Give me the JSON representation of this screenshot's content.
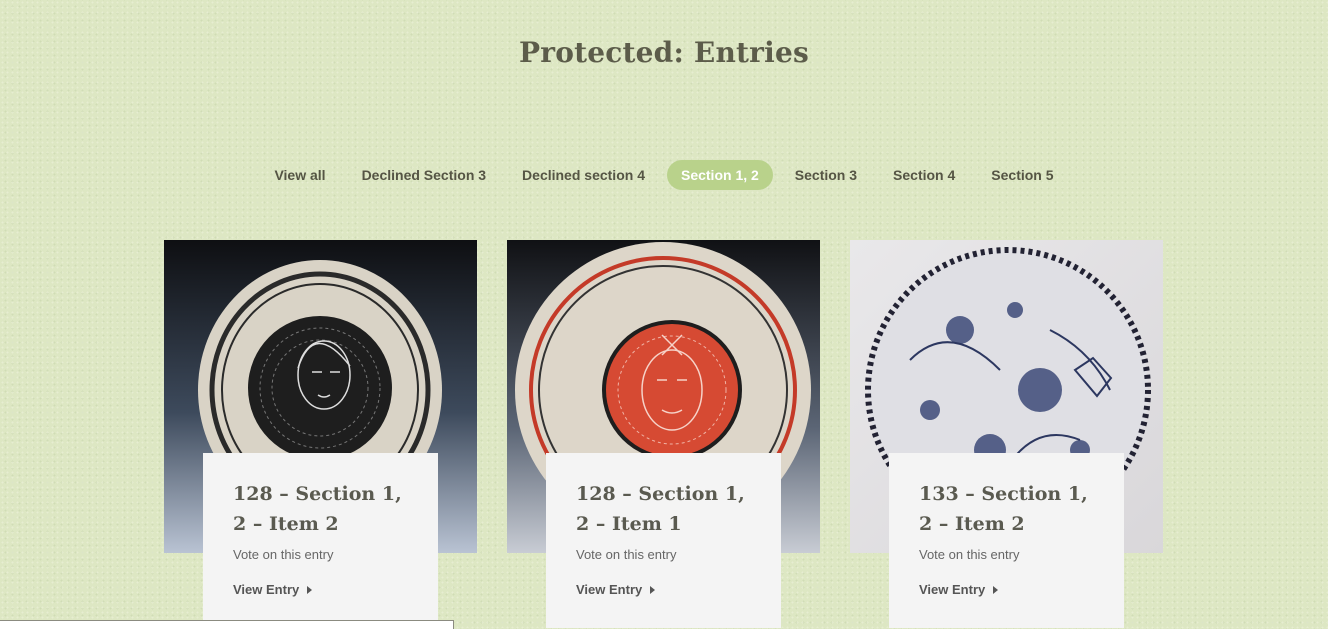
{
  "page": {
    "title": "Protected: Entries"
  },
  "filters": [
    {
      "label": "View all",
      "active": false
    },
    {
      "label": "Declined Section 3",
      "active": false
    },
    {
      "label": "Declined section 4",
      "active": false
    },
    {
      "label": "Section 1, 2",
      "active": true
    },
    {
      "label": "Section 3",
      "active": false
    },
    {
      "label": "Section 4",
      "active": false
    },
    {
      "label": "Section 5",
      "active": false
    }
  ],
  "entries": [
    {
      "title": "128 – Section 1, 2 – Item 2",
      "subtitle": "Vote on this entry",
      "link": "View Entry",
      "image": "black-white-sgraffito-plate-portrait"
    },
    {
      "title": "128 – Section 1, 2 – Item 1",
      "subtitle": "Vote on this entry",
      "link": "View Entry",
      "image": "red-sgraffito-plate-mask"
    },
    {
      "title": "133 – Section 1, 2 – Item 2",
      "subtitle": "Vote on this entry",
      "link": "View Entry",
      "image": "blue-floral-plate"
    }
  ],
  "colors": {
    "accent": "#b9d28b",
    "background": "#dde7c3",
    "text": "#5c5c4a"
  }
}
